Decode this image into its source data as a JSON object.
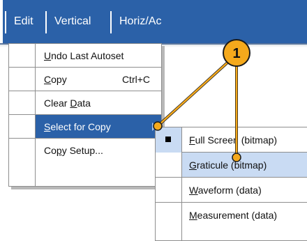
{
  "menubar": {
    "items": [
      {
        "label": "Edit"
      },
      {
        "label": "Vertical"
      },
      {
        "label": "Horiz/Ac"
      }
    ]
  },
  "edit_menu": {
    "items": [
      {
        "label_pre": "",
        "mnemonic": "U",
        "label_post": "ndo Last Autoset",
        "shortcut": ""
      },
      {
        "label_pre": "",
        "mnemonic": "C",
        "label_post": "opy",
        "shortcut": "Ctrl+C"
      },
      {
        "label_pre": "Clear ",
        "mnemonic": "D",
        "label_post": "ata",
        "shortcut": ""
      },
      {
        "label_pre": "",
        "mnemonic": "S",
        "label_post": "elect for Copy",
        "shortcut": ""
      },
      {
        "label_pre": "Co",
        "mnemonic": "p",
        "label_post": "y Setup...",
        "shortcut": ""
      }
    ]
  },
  "copy_submenu": {
    "items": [
      {
        "label_pre": "",
        "mnemonic": "F",
        "label_post": "ull Screen (bitmap)",
        "checked": true
      },
      {
        "label_pre": "",
        "mnemonic": "G",
        "label_post": "raticule (bitmap)",
        "checked": false
      },
      {
        "label_pre": "",
        "mnemonic": "W",
        "label_post": "aveform (data)",
        "checked": false
      },
      {
        "label_pre": "",
        "mnemonic": "M",
        "label_post": "easurement (data)",
        "checked": false
      }
    ]
  },
  "callout": {
    "number": "1",
    "color": "#f5a91c"
  },
  "colors": {
    "menubar": "#2b61a8",
    "highlight": "#c9dbf3"
  }
}
